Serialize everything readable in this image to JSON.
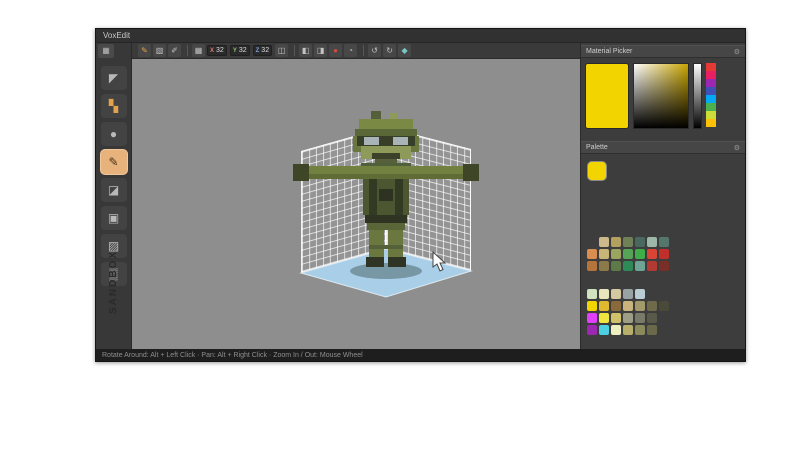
{
  "window": {
    "title": "VoxEdit"
  },
  "statusbar": {
    "hints": "Rotate Around: Alt + Left Click · Pan: Alt + Right Click · Zoom In / Out: Mouse Wheel"
  },
  "branding": {
    "vertical_text": "SANDBOX"
  },
  "toolbar": {
    "items": [
      {
        "type": "icon",
        "name": "brush-icon",
        "glyph": "✎",
        "color": "#e2a24c"
      },
      {
        "type": "icon",
        "name": "wand-icon",
        "glyph": "▧",
        "color": "#c2c2c2"
      },
      {
        "type": "icon",
        "name": "dropper-icon",
        "glyph": "✐",
        "color": "#c2c2c2"
      },
      {
        "type": "sep"
      },
      {
        "type": "icon",
        "name": "resize-grid-icon",
        "glyph": "▦",
        "color": "#c2c2c2"
      },
      {
        "type": "field",
        "name": "size-x-field",
        "label": "X",
        "label_color": "#d97b6c",
        "value": "32"
      },
      {
        "type": "field",
        "name": "size-y-field",
        "label": "Y",
        "label_color": "#8fbf6f",
        "value": "32"
      },
      {
        "type": "field",
        "name": "size-z-field",
        "label": "Z",
        "label_color": "#7b9fd9",
        "value": "32"
      },
      {
        "type": "icon",
        "name": "lock-icon",
        "glyph": "◫",
        "color": "#c2c2c2"
      },
      {
        "type": "sep"
      },
      {
        "type": "icon",
        "name": "mirror-x-icon",
        "glyph": "◧",
        "color": "#c2c2c2"
      },
      {
        "type": "icon",
        "name": "mirror-y-icon",
        "glyph": "◨",
        "color": "#c2c2c2"
      },
      {
        "type": "icon",
        "name": "record-icon",
        "glyph": "●",
        "color": "#cf4b3d"
      },
      {
        "type": "icon",
        "name": "ghost-icon",
        "glyph": "◔",
        "color": "#c2c2c2"
      },
      {
        "type": "sep"
      },
      {
        "type": "icon",
        "name": "undo-icon",
        "glyph": "↺",
        "color": "#c2c2c2"
      },
      {
        "type": "icon",
        "name": "redo-icon",
        "glyph": "↻",
        "color": "#c2c2c2"
      },
      {
        "type": "icon",
        "name": "gem-icon",
        "glyph": "◆",
        "color": "#79c8c8"
      }
    ]
  },
  "sidebar": {
    "top_button_glyph": "▦",
    "tools": [
      {
        "name": "select-tool",
        "glyph": "◤",
        "color": "#b9b9b9",
        "active": false
      },
      {
        "name": "blocks-tool",
        "glyph": "▚",
        "color": "#e2a24c",
        "active": false
      },
      {
        "name": "sphere-tool",
        "glyph": "●",
        "color": "#b9b9b9",
        "active": false
      },
      {
        "name": "pencil-tool",
        "glyph": "✎",
        "color": "#4a3014",
        "active": true
      },
      {
        "name": "eraser-tool",
        "glyph": "◪",
        "color": "#b9b9b9",
        "active": false
      },
      {
        "name": "cube-tool",
        "glyph": "▣",
        "color": "#b9b9b9",
        "active": false
      },
      {
        "name": "bucket-tool",
        "glyph": "▨",
        "color": "#b9b9b9",
        "active": false
      },
      {
        "name": "spray-tool",
        "glyph": "▒",
        "color": "#b9b9b9",
        "active": false
      }
    ]
  },
  "material_picker": {
    "title": "Material Picker",
    "options_icon": "⚙",
    "current_color": "#f2d500",
    "gradient_hue": "#c8a400",
    "value_ramp_start": "#ffffff",
    "value_ramp_end": "#000000",
    "hue_blocks": [
      "#e53935",
      "#e91e63",
      "#9c27b0",
      "#3f51b5",
      "#03a9f4",
      "#4caf50",
      "#cddc39",
      "#ffc107"
    ]
  },
  "palette": {
    "title": "Palette",
    "options_icon": "⚙",
    "selected": "#f2d500",
    "groups": [
      {
        "rows": [
          [
            "",
            "#cdb98c",
            "#b3a15f",
            "#6f8257",
            "#49685e",
            "#9db7a9",
            "#53776b"
          ],
          [
            "#d98e4f",
            "#c9b478",
            "#9aa55f",
            "#56a556",
            "#3fae49",
            "#d94436",
            "#c22f2a"
          ],
          [
            "#b5743c",
            "#8a7a4a",
            "#5d7a48",
            "#2e8b57",
            "#6fa393",
            "#b23a32",
            "#7a2e28"
          ]
        ]
      },
      {
        "rows": [
          [
            "#cfe3c0",
            "#e8e4bc",
            "#d5c9a2",
            "#9aa3a3",
            "#b9cdd2",
            "",
            "",
            ""
          ],
          [
            "#f2d500",
            "#e0b92e",
            "#8a6a3a",
            "#c9b47e",
            "#a39a6a",
            "#6f6a4a",
            "#4a4a3a",
            ""
          ],
          [
            "#e040fb",
            "#f0e642",
            "#cfc06a",
            "#9e9e86",
            "#7a7a6a",
            "#5a5a4a",
            "",
            ""
          ],
          [
            "#9c27b0",
            "#4dd0e1",
            "#eef0c0",
            "#b8b06a",
            "#8a8a5a",
            "#6a6a4a",
            "",
            ""
          ]
        ]
      }
    ]
  },
  "scene": {
    "floor_color": "#a9cfe8",
    "model_rects": [
      [
        100,
        0,
        10,
        8,
        "#55603a"
      ],
      [
        118,
        2,
        8,
        6,
        "#8e9a5a"
      ],
      [
        88,
        8,
        54,
        10,
        "#7a8a45"
      ],
      [
        84,
        18,
        62,
        7,
        "#5a6838"
      ],
      [
        82,
        25,
        8,
        16,
        "#6a7840"
      ],
      [
        140,
        25,
        8,
        16,
        "#6a7840"
      ],
      [
        86,
        25,
        58,
        10,
        "#383f28"
      ],
      [
        93,
        26,
        15,
        8,
        "#a8b4b8"
      ],
      [
        122,
        26,
        15,
        8,
        "#a8b4b8"
      ],
      [
        90,
        35,
        50,
        13,
        "#8e9a5a"
      ],
      [
        101,
        42,
        28,
        6,
        "#3c4229"
      ],
      [
        104,
        48,
        22,
        7,
        "#55603a"
      ],
      [
        90,
        52,
        50,
        6,
        "#50603a"
      ],
      [
        36,
        55,
        158,
        13,
        "#72813f"
      ],
      [
        36,
        63,
        158,
        5,
        "#5f6c35"
      ],
      [
        22,
        53,
        16,
        17,
        "#3f4628"
      ],
      [
        192,
        53,
        16,
        17,
        "#3f4628"
      ],
      [
        92,
        68,
        46,
        36,
        "#4c5631"
      ],
      [
        98,
        68,
        8,
        36,
        "#333a24"
      ],
      [
        124,
        68,
        8,
        36,
        "#333a24"
      ],
      [
        108,
        78,
        14,
        12,
        "#2d3320"
      ],
      [
        94,
        104,
        42,
        8,
        "#2e3322"
      ],
      [
        96,
        112,
        38,
        7,
        "#5a6638"
      ],
      [
        98,
        119,
        15,
        27,
        "#6a7840"
      ],
      [
        117,
        119,
        15,
        27,
        "#6a7840"
      ],
      [
        98,
        134,
        34,
        4,
        "#55613a"
      ],
      [
        95,
        146,
        18,
        10,
        "#2f3424"
      ],
      [
        117,
        146,
        18,
        10,
        "#2f3424"
      ]
    ]
  }
}
